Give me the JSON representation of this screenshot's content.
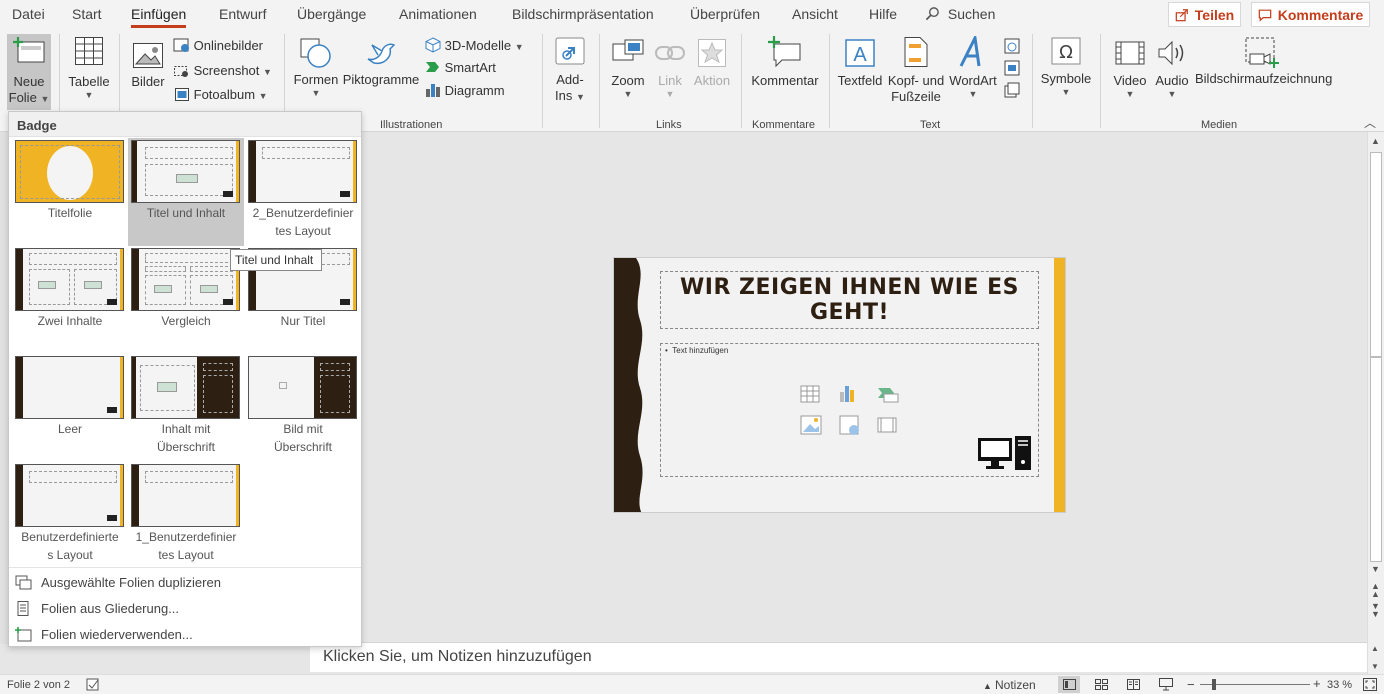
{
  "menu": {
    "tabs": [
      "Datei",
      "Start",
      "Einfügen",
      "Entwurf",
      "Übergänge",
      "Animationen",
      "Bildschirmpräsentation",
      "Überprüfen",
      "Ansicht",
      "Hilfe"
    ],
    "active_tab": "Einfügen",
    "search": "Suchen",
    "share": "Teilen",
    "comments": "Kommentare"
  },
  "ribbon": {
    "new_slide": [
      "Neue",
      "Folie"
    ],
    "table": "Tabelle",
    "images": "Bilder",
    "online_images": "Onlinebilder",
    "screenshot": "Screenshot",
    "photo_album": "Fotoalbum",
    "shapes": "Formen",
    "icons": "Piktogramme",
    "models3d": "3D-Modelle",
    "smartart": "SmartArt",
    "chart": "Diagramm",
    "addins": [
      "Add-",
      "Ins"
    ],
    "zoom": "Zoom",
    "link": "Link",
    "action": "Aktion",
    "comment": "Kommentar",
    "textbox": "Textfeld",
    "header_footer": [
      "Kopf- und",
      "Fußzeile"
    ],
    "wordart": "WordArt",
    "symbols": "Symbole",
    "video": "Video",
    "audio": "Audio",
    "screen_recording": "Bildschirmaufzeichnung",
    "groups": {
      "illustrations": "Illustrationen",
      "links": "Links",
      "comments": "Kommentare",
      "text": "Text",
      "media": "Medien"
    }
  },
  "dropdown": {
    "header": "Badge",
    "layouts": [
      {
        "name": [
          "Titelfolie",
          ""
        ]
      },
      {
        "name": [
          "Titel und Inhalt",
          ""
        ]
      },
      {
        "name": [
          "2_Benutzerdefinier",
          "tes Layout"
        ]
      },
      {
        "name": [
          "Zwei Inhalte",
          ""
        ]
      },
      {
        "name": [
          "Vergleich",
          ""
        ]
      },
      {
        "name": [
          "Nur Titel",
          ""
        ]
      },
      {
        "name": [
          "Leer",
          ""
        ]
      },
      {
        "name": [
          "Inhalt mit",
          "Überschrift"
        ]
      },
      {
        "name": [
          "Bild mit",
          "Überschrift"
        ]
      },
      {
        "name": [
          "Benutzerdefinierte",
          "s Layout"
        ]
      },
      {
        "name": [
          "1_Benutzerdefinier",
          "tes Layout"
        ]
      }
    ],
    "selected_layout": "Titel und Inhalt",
    "commands": [
      "Ausgewählte Folien duplizieren",
      "Folien aus Gliederung...",
      "Folien wiederverwenden..."
    ]
  },
  "tooltip": "Titel und Inhalt",
  "slide": {
    "title": "WIR ZEIGEN IHNEN WIE ES GEHT!",
    "body_placeholder": "Text hinzufügen"
  },
  "notes_placeholder": "Klicken Sie, um Notizen hinzuzufügen",
  "status": {
    "slide_info": "Folie 2 von 2",
    "notes": "Notizen",
    "zoom": "33 %"
  },
  "colors": {
    "accent": "#c43e1c",
    "brown": "#2d1f12",
    "gold": "#f0b323"
  }
}
